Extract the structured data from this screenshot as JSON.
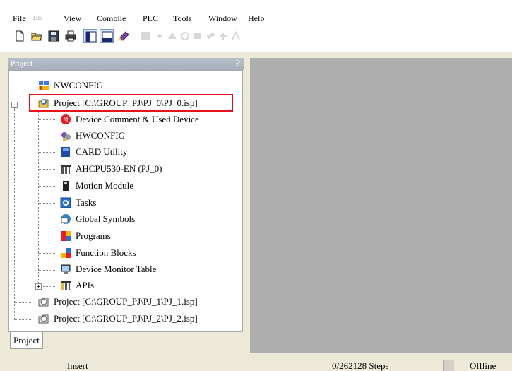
{
  "menu": {
    "file": "File",
    "edit": "Edit",
    "view": "View",
    "compile": "Compile",
    "plc": "PLC",
    "tools": "Tools",
    "window": "Window",
    "help": "Help"
  },
  "toolbar": {
    "icons": [
      "new-file-icon",
      "open-folder-icon",
      "save-icon",
      "print-icon",
      "project-panel-icon",
      "output-window-icon",
      "device-icon",
      "disabled-icon-1",
      "disabled-icon-2",
      "disabled-icon-3",
      "disabled-icon-4",
      "disabled-icon-5",
      "disabled-icon-6",
      "disabled-icon-7",
      "disabled-icon-8"
    ]
  },
  "panel": {
    "title": "Project",
    "pin": "₽"
  },
  "tree": {
    "nwconfig": "NWCONFIG",
    "project0": "Project [C:\\GROUP_PJ\\PJ_0\\PJ_0.isp]",
    "device_comment": "Device Comment & Used Device",
    "hwconfig": "HWCONFIG",
    "card_utility": "CARD Utility",
    "cpu": "AHCPU530-EN  (PJ_0)",
    "motion_module": "Motion Module",
    "tasks": "Tasks",
    "global_symbols": "Global Symbols",
    "programs": "Programs",
    "function_blocks": "Function Blocks",
    "device_monitor_table": "Device Monitor Table",
    "apis": "APIs",
    "project1": "Project [C:\\GROUP_PJ\\PJ_1\\PJ_1.isp]",
    "project2": "Project [C:\\GROUP_PJ\\PJ_2\\PJ_2.isp]"
  },
  "bottom_tab": "Project",
  "status": {
    "mode": "Insert",
    "steps": "0/262128 Steps",
    "connection": "Offline"
  },
  "colors": {
    "highlight": "#e8101a",
    "workarea": "#aeaeae"
  }
}
